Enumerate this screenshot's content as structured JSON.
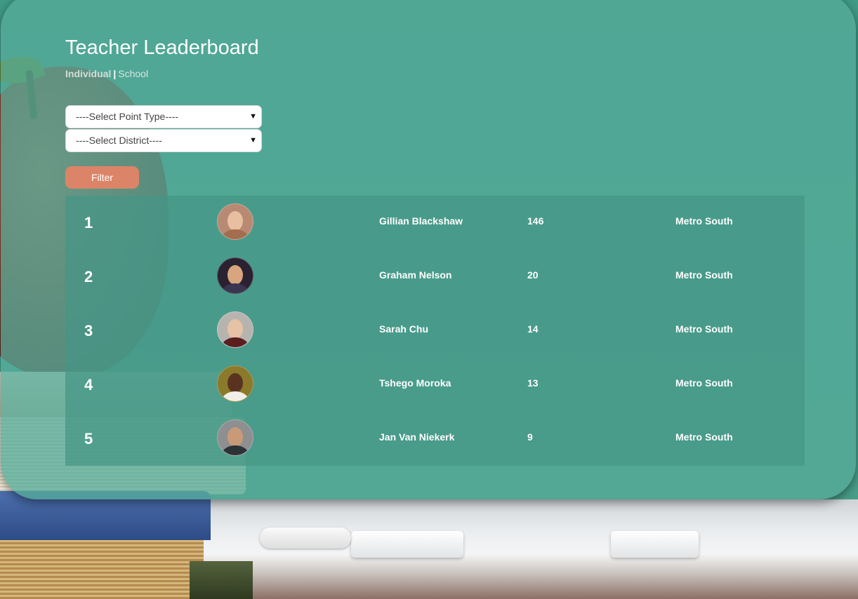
{
  "page": {
    "title": "Teacher Leaderboard",
    "tabs": [
      {
        "label": "Individual",
        "active": true
      },
      {
        "label": "School",
        "active": false
      }
    ],
    "separator": "|"
  },
  "filters": {
    "point_type": {
      "selected": "----Select Point Type----"
    },
    "district": {
      "selected": "----Select District----"
    },
    "filter_label": "Filter"
  },
  "leaderboard": [
    {
      "rank": "1",
      "name": "Gillian Blackshaw",
      "points": "146",
      "district": "Metro South",
      "avatar": "avatar-photo"
    },
    {
      "rank": "2",
      "name": "Graham Nelson",
      "points": "20",
      "district": "Metro South",
      "avatar": "avatar-photo"
    },
    {
      "rank": "3",
      "name": "Sarah Chu",
      "points": "14",
      "district": "Metro South",
      "avatar": "avatar-photo"
    },
    {
      "rank": "4",
      "name": "Tshego Moroka",
      "points": "13",
      "district": "Metro South",
      "avatar": "avatar-photo"
    },
    {
      "rank": "5",
      "name": "Jan Van Niekerk",
      "points": "9",
      "district": "Metro South",
      "avatar": "avatar-photo"
    }
  ],
  "colors": {
    "panel": "#54aa98",
    "filter_button": "#dc8467",
    "text": "#ffffff"
  }
}
